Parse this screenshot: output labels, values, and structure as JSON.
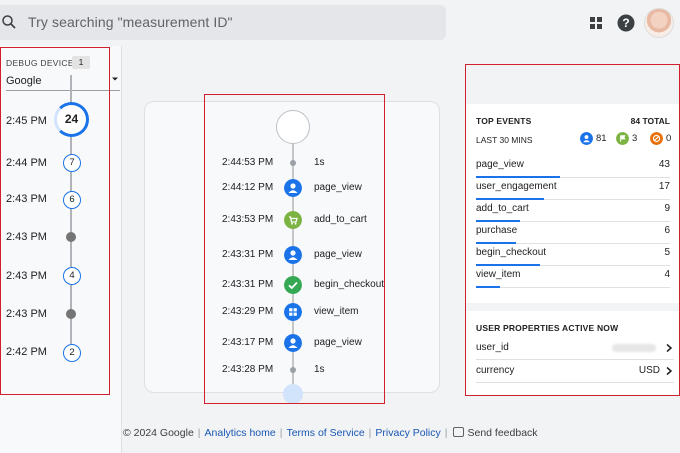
{
  "search": {
    "placeholder": "Try searching \"measurement ID\""
  },
  "icons": {
    "search": "search-icon",
    "apps": "apps-grid-icon",
    "help": "help-icon",
    "dropdown": "chevron-down-icon"
  },
  "colors": {
    "accent": "#1a73e8",
    "highlight": "#d0202d",
    "green": "#34a853",
    "olive": "#7cb342",
    "orange": "#e8710a"
  },
  "debug_device": {
    "label": "DEBUG DEVICE",
    "count": "1",
    "selected": "Google"
  },
  "timeline": [
    {
      "time": "2:45 PM",
      "count": "24"
    },
    {
      "time": "2:44 PM",
      "count": "7"
    },
    {
      "time": "2:43 PM",
      "count": "6"
    },
    {
      "time": "2:43 PM",
      "count": ""
    },
    {
      "time": "2:43 PM",
      "count": "4"
    },
    {
      "time": "2:43 PM",
      "count": ""
    },
    {
      "time": "2:42 PM",
      "count": "2"
    }
  ],
  "event_stream": [
    {
      "time": "2:44:53 PM",
      "name": "1s",
      "icon": "dot"
    },
    {
      "time": "2:44:12 PM",
      "name": "page_view",
      "icon": "person-icon"
    },
    {
      "time": "2:43:53 PM",
      "name": "add_to_cart",
      "icon": "cart-icon"
    },
    {
      "time": "2:43:31 PM",
      "name": "page_view",
      "icon": "person-icon"
    },
    {
      "time": "2:43:31 PM",
      "name": "begin_checkout",
      "icon": "check-icon"
    },
    {
      "time": "2:43:29 PM",
      "name": "view_item",
      "icon": "grid-icon"
    },
    {
      "time": "2:43:17 PM",
      "name": "page_view",
      "icon": "person-icon"
    },
    {
      "time": "2:43:28 PM",
      "name": "1s",
      "icon": "dot"
    }
  ],
  "top_events": {
    "title": "TOP EVENTS",
    "total": "84 TOTAL",
    "period": "LAST 30 MINS",
    "counts": [
      {
        "value": "81",
        "icon": "person-icon"
      },
      {
        "value": "3",
        "icon": "flag-icon"
      },
      {
        "value": "0",
        "icon": "error-icon"
      }
    ],
    "rows": [
      {
        "name": "page_view",
        "value": "43",
        "share": 1.0
      },
      {
        "name": "user_engagement",
        "value": "17",
        "share": 0.81
      },
      {
        "name": "add_to_cart",
        "value": "9",
        "share": 0.52
      },
      {
        "name": "purchase",
        "value": "6",
        "share": 0.48
      },
      {
        "name": "begin_checkout",
        "value": "5",
        "share": 0.76
      },
      {
        "name": "view_item",
        "value": "4",
        "share": 0.28
      }
    ]
  },
  "user_properties": {
    "title": "USER PROPERTIES ACTIVE NOW",
    "rows": [
      {
        "key": "user_id",
        "value": ""
      },
      {
        "key": "currency",
        "value": "USD"
      }
    ]
  },
  "footer": {
    "copyright": "© 2024 Google",
    "links": [
      "Analytics home",
      "Terms of Service",
      "Privacy Policy"
    ],
    "feedback": "Send feedback"
  }
}
